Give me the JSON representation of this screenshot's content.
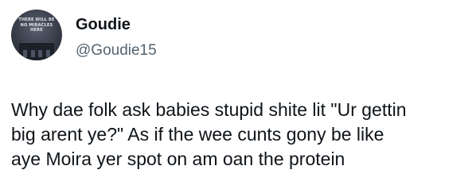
{
  "author": {
    "display_name": "Goudie",
    "handle": "@Goudie15",
    "avatar": {
      "icon": "profile-photo-neon-sign",
      "sign_lines": [
        "THERE WILL BE",
        "NO MIRACLES",
        "HERE"
      ]
    }
  },
  "tweet": {
    "lines": [
      "Why dae folk ask babies stupid shite lit \"Ur gettin",
      "big arent ye?\" As if the wee cunts gony be like",
      "aye Moira yer spot on am oan the protein"
    ]
  },
  "colors": {
    "text_primary": "#0f1419",
    "text_secondary": "#536471",
    "background": "#ffffff"
  }
}
